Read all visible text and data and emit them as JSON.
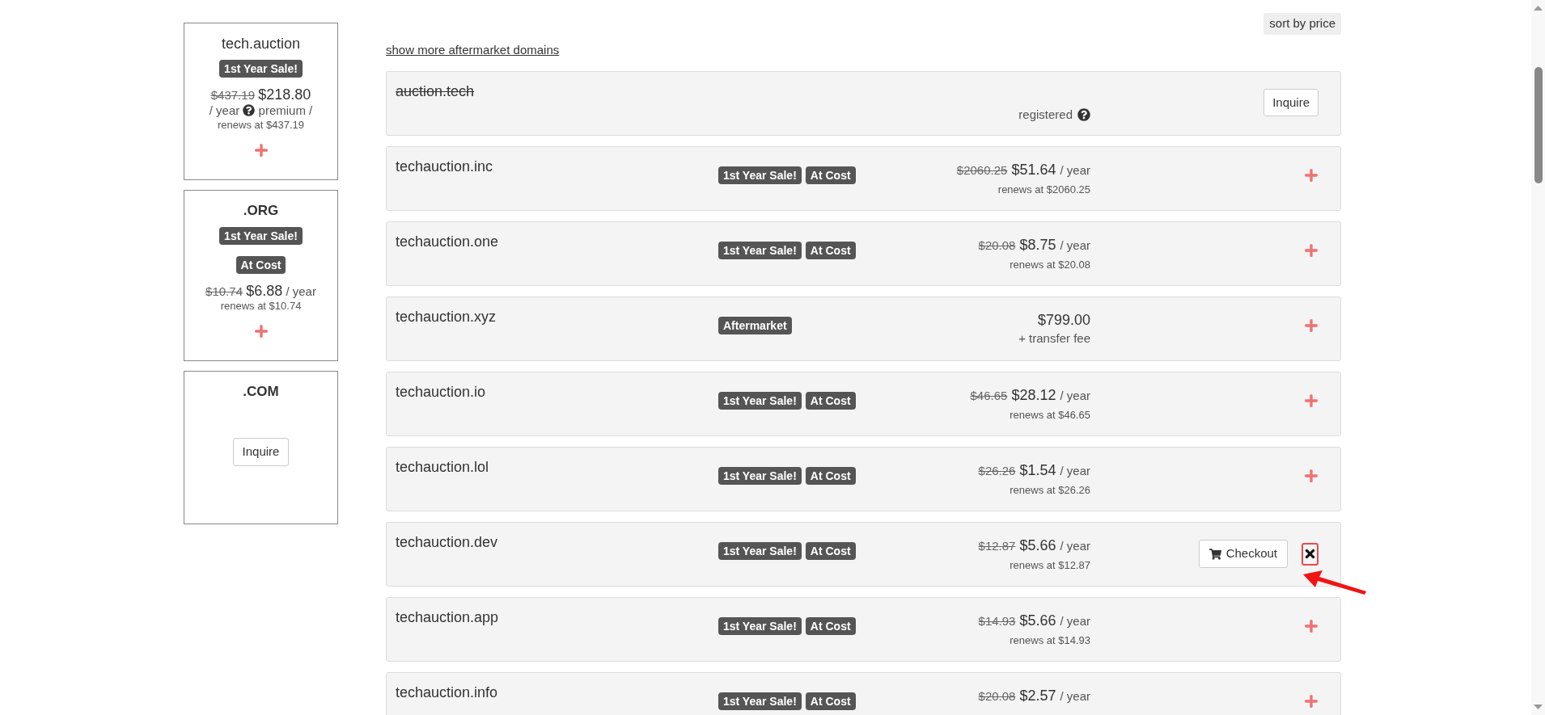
{
  "sidebar": {
    "cards": [
      {
        "kind": "domain",
        "title": "tech.auction",
        "badges": [
          "1st Year Sale!"
        ],
        "old_price": "$437.19",
        "price": "$218.80",
        "unit": "/ year",
        "note": "premium /",
        "renews": "renews at $437.19",
        "action": {
          "kind": "add"
        }
      },
      {
        "kind": "extension",
        "title": ".ORG",
        "badges": [
          "1st Year Sale!",
          "At Cost"
        ],
        "old_price": "$10.74",
        "price": "$6.88",
        "unit": "/ year",
        "renews": "renews at $10.74",
        "action": {
          "kind": "add"
        }
      },
      {
        "kind": "extension",
        "title": ".COM",
        "action": {
          "kind": "inquire",
          "label": "Inquire"
        }
      }
    ]
  },
  "main": {
    "sort_button": "sort by price",
    "more_link": "show more aftermarket domains",
    "results": [
      {
        "domain": "auction.tech",
        "taken": true,
        "status": "registered",
        "action": {
          "kind": "inquire",
          "label": "Inquire"
        }
      },
      {
        "domain": "techauction.inc",
        "taken": false,
        "badges": [
          "1st Year Sale!",
          "At Cost"
        ],
        "old_price": "$2060.25",
        "price": "$51.64",
        "unit": "/ year",
        "renews": "renews at $2060.25",
        "action": {
          "kind": "add"
        }
      },
      {
        "domain": "techauction.one",
        "taken": false,
        "badges": [
          "1st Year Sale!",
          "At Cost"
        ],
        "old_price": "$20.08",
        "price": "$8.75",
        "unit": "/ year",
        "renews": "renews at $20.08",
        "action": {
          "kind": "add"
        }
      },
      {
        "domain": "techauction.xyz",
        "taken": false,
        "badges": [
          "Aftermarket"
        ],
        "price": "$799.00",
        "note": "+ transfer fee",
        "action": {
          "kind": "add"
        }
      },
      {
        "domain": "techauction.io",
        "taken": false,
        "badges": [
          "1st Year Sale!",
          "At Cost"
        ],
        "old_price": "$46.65",
        "price": "$28.12",
        "unit": "/ year",
        "renews": "renews at $46.65",
        "action": {
          "kind": "add"
        }
      },
      {
        "domain": "techauction.lol",
        "taken": false,
        "badges": [
          "1st Year Sale!",
          "At Cost"
        ],
        "old_price": "$26.26",
        "price": "$1.54",
        "unit": "/ year",
        "renews": "renews at $26.26",
        "action": {
          "kind": "add"
        }
      },
      {
        "domain": "techauction.dev",
        "taken": false,
        "badges": [
          "1st Year Sale!",
          "At Cost"
        ],
        "old_price": "$12.87",
        "price": "$5.66",
        "unit": "/ year",
        "renews": "renews at $12.87",
        "action": {
          "kind": "in_cart",
          "label": "Checkout"
        },
        "highlighted": true
      },
      {
        "domain": "techauction.app",
        "taken": false,
        "badges": [
          "1st Year Sale!",
          "At Cost"
        ],
        "old_price": "$14.93",
        "price": "$5.66",
        "unit": "/ year",
        "renews": "renews at $14.93",
        "action": {
          "kind": "add"
        }
      },
      {
        "domain": "techauction.info",
        "taken": false,
        "badges": [
          "1st Year Sale!",
          "At Cost"
        ],
        "old_price": "$20.08",
        "price": "$2.57",
        "unit": "/ year",
        "action": {
          "kind": "add"
        }
      }
    ]
  }
}
